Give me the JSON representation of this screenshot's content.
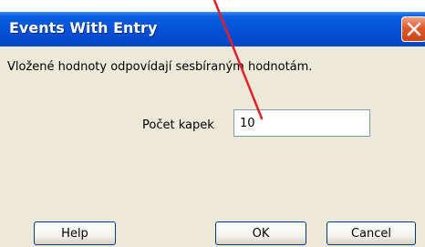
{
  "window": {
    "title": "Events With Entry",
    "close_icon": "close-icon"
  },
  "message": "Vložené hodnoty odpovídají sesbíraným hodnotám.",
  "field": {
    "label": "Počet kapek",
    "value": "10"
  },
  "buttons": {
    "help": "Help",
    "ok": "OK",
    "cancel": "Cancel"
  },
  "annotation": {
    "color": "#e0202a"
  }
}
